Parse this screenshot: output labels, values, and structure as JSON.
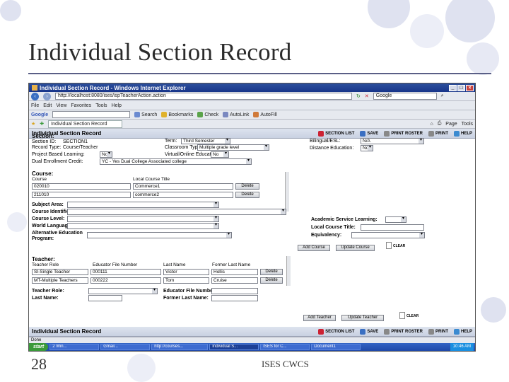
{
  "slide": {
    "title": "Individual Section Record",
    "page_number": "28",
    "footer": "ISES CWCS"
  },
  "browser": {
    "window_title": "Individual Section Record - Windows Internet Explorer",
    "address": "http://localhost:8080/ises/ispTeacherAction.action",
    "search_engine": "Google",
    "menu": [
      "File",
      "Edit",
      "View",
      "Favorites",
      "Tools",
      "Help"
    ],
    "google_bar": {
      "label": "Google",
      "items": [
        "Search",
        "Bookmarks",
        "Check",
        "AutoLink",
        "AutoFill"
      ]
    },
    "tab_label": "Individual Section Record",
    "tab_tools": [
      "Page",
      "Tools"
    ],
    "status_text": "Done"
  },
  "app": {
    "header_title": "Individual Section Record",
    "actions": [
      "SECTION LIST",
      "SAVE",
      "PRINT ROSTER",
      "PRINT",
      "HELP"
    ],
    "footer_title": "Individual Section Record",
    "section": {
      "heading": "Section:",
      "section_id_label": "Section ID:",
      "section_id": "SECTION1",
      "record_type_label": "Record Type:",
      "record_type": "Course/Teacher",
      "project_based_label": "Project Based Learning:",
      "project_based": "No",
      "dual_enrollment_label": "Dual Enrollment Credit:",
      "dual_enrollment": "YC - Yes Dual College Associated college",
      "term_label": "Term:",
      "term": "Third Semester",
      "classroom_type_label": "Classroom Type:",
      "classroom_type": "Multiple grade level",
      "virtual_label": "Virtual/Online Education:",
      "virtual": "No",
      "bilingual_label": "Bilingual/ESL:",
      "bilingual": "N/A",
      "distance_label": "Distance Education:",
      "distance": "No"
    },
    "course": {
      "heading": "Course:",
      "col_course": "Course",
      "col_local_title": "Local Course Title",
      "rows": [
        {
          "course": "020010",
          "title": "Commerce1",
          "action": "Delete"
        },
        {
          "course": "211010",
          "title": "commerce2",
          "action": "Delete"
        }
      ],
      "subject_area_label": "Subject Area:",
      "course_identifier_label": "Course Identifier:",
      "course_level_label": "Course Level:",
      "world_language_label": "World Language:",
      "alt_ed_label": "Alternative Education Program:",
      "academic_service_label": "Academic Service Learning:",
      "local_title_label": "Local Course Title:",
      "equivalency_label": "Equivalency:",
      "clear_label": "CLEAR",
      "add_button": "Add Course",
      "update_button": "Update Course"
    },
    "teacher": {
      "heading": "Teacher:",
      "col_role": "Teacher Role",
      "col_edfile": "Educator File Number",
      "col_last": "Last Name",
      "col_former": "Former Last Name",
      "rows": [
        {
          "role": "SI-Single Teacher",
          "edfile": "000111",
          "last": "Victor",
          "former": "Hollis",
          "action": "Delete"
        },
        {
          "role": "MT-Multiple Teachers",
          "edfile": "000222",
          "last": "Tom",
          "former": "Cruise",
          "action": "Delete"
        }
      ],
      "role_label": "Teacher Role:",
      "last_name_label": "Last Name:",
      "edfile_label": "Educator File Number:",
      "former_label": "Former Last Name:",
      "add_button": "Add Teacher",
      "update_button": "Update Teacher",
      "clear_label": "CLEAR"
    }
  },
  "taskbar": {
    "start": "start",
    "tasks": [
      "2 Win...",
      "Gmail...",
      "http://courses...",
      "Individual S...",
      "ISES for C...",
      "Document1"
    ],
    "clock": "10:46 AM"
  },
  "colors": {
    "accent": "#5a5f86",
    "bubble": "#dfe2f0",
    "title_bar": "#1f3f92"
  }
}
